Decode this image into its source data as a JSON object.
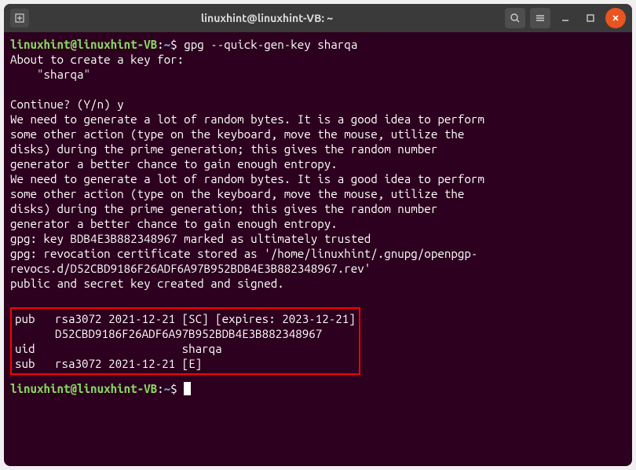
{
  "window": {
    "title": "linuxhint@linuxhint-VB: ~"
  },
  "prompt": {
    "user_host": "linuxhint@linuxhint-VB",
    "path": "~",
    "symbol": "$"
  },
  "command1": "gpg --quick-gen-key sharqa",
  "output": {
    "about": "About to create a key for:",
    "keyname": "    \"sharqa\"",
    "continue": "Continue? (Y/n) y",
    "random1": "We need to generate a lot of random bytes. It is a good idea to perform\nsome other action (type on the keyboard, move the mouse, utilize the\ndisks) during the prime generation; this gives the random number\ngenerator a better chance to gain enough entropy.",
    "random2": "We need to generate a lot of random bytes. It is a good idea to perform\nsome other action (type on the keyboard, move the mouse, utilize the\ndisks) during the prime generation; this gives the random number\ngenerator a better chance to gain enough entropy.",
    "trusted": "gpg: key BDB4E3B882348967 marked as ultimately trusted",
    "revoc": "gpg: revocation certificate stored as '/home/linuxhint/.gnupg/openpgp-revocs.d/D52CBD9186F26ADF6A97B952BDB4E3B882348967.rev'",
    "created": "public and secret key created and signed."
  },
  "keyblock": {
    "pub": "pub   rsa3072 2021-12-21 [SC] [expires: 2023-12-21]",
    "fpr": "      D52CBD9186F26ADF6A97B952BDB4E3B882348967",
    "uid": "uid                      sharqa",
    "sub": "sub   rsa3072 2021-12-21 [E]"
  }
}
